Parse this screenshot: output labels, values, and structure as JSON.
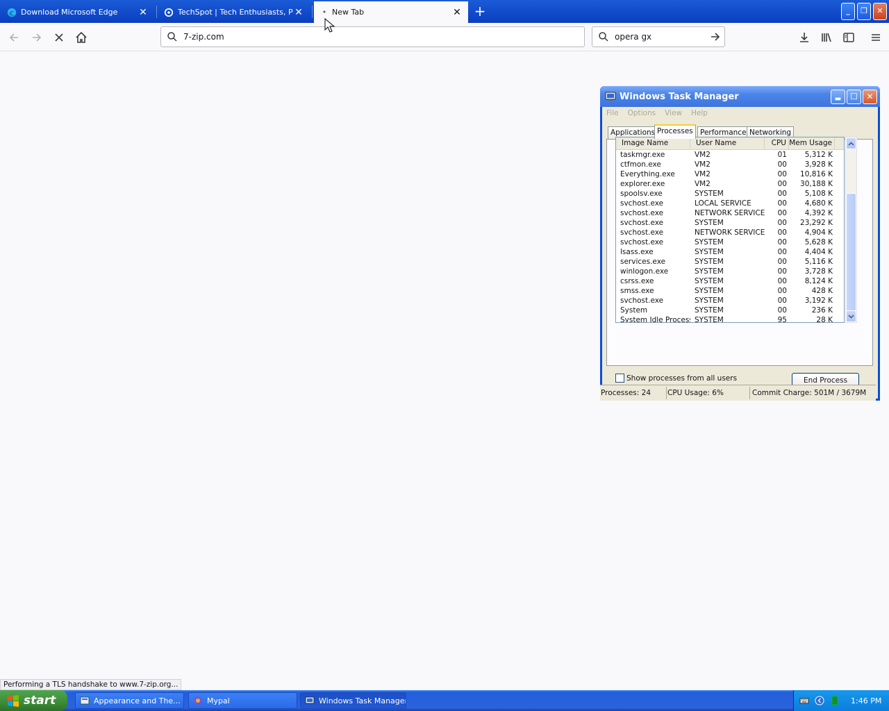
{
  "browser": {
    "tabs": [
      {
        "title": "Download Microsoft Edge",
        "active": false
      },
      {
        "title": "TechSpot | Tech Enthusiasts, Power Users",
        "active": false
      },
      {
        "title": "New Tab",
        "active": true
      }
    ],
    "url": "7-zip.com",
    "search_value": "opera gx",
    "status_text": "Performing a TLS handshake to www.7-zip.org..."
  },
  "task_manager": {
    "title": "Windows Task Manager",
    "menu": [
      "File",
      "Options",
      "View",
      "Help"
    ],
    "tabs": [
      "Applications",
      "Processes",
      "Performance",
      "Networking"
    ],
    "active_tab": "Processes",
    "columns": [
      "Image Name",
      "User Name",
      "CPU",
      "Mem Usage"
    ],
    "processes": [
      {
        "name": "taskmgr.exe",
        "user": "VM2",
        "cpu": "01",
        "mem": "5,312 K"
      },
      {
        "name": "ctfmon.exe",
        "user": "VM2",
        "cpu": "00",
        "mem": "3,928 K"
      },
      {
        "name": "Everything.exe",
        "user": "VM2",
        "cpu": "00",
        "mem": "10,816 K"
      },
      {
        "name": "explorer.exe",
        "user": "VM2",
        "cpu": "00",
        "mem": "30,188 K"
      },
      {
        "name": "spoolsv.exe",
        "user": "SYSTEM",
        "cpu": "00",
        "mem": "5,108 K"
      },
      {
        "name": "svchost.exe",
        "user": "LOCAL SERVICE",
        "cpu": "00",
        "mem": "4,680 K"
      },
      {
        "name": "svchost.exe",
        "user": "NETWORK SERVICE",
        "cpu": "00",
        "mem": "4,392 K"
      },
      {
        "name": "svchost.exe",
        "user": "SYSTEM",
        "cpu": "00",
        "mem": "23,292 K"
      },
      {
        "name": "svchost.exe",
        "user": "NETWORK SERVICE",
        "cpu": "00",
        "mem": "4,904 K"
      },
      {
        "name": "svchost.exe",
        "user": "SYSTEM",
        "cpu": "00",
        "mem": "5,628 K"
      },
      {
        "name": "lsass.exe",
        "user": "SYSTEM",
        "cpu": "00",
        "mem": "4,404 K"
      },
      {
        "name": "services.exe",
        "user": "SYSTEM",
        "cpu": "00",
        "mem": "5,116 K"
      },
      {
        "name": "winlogon.exe",
        "user": "SYSTEM",
        "cpu": "00",
        "mem": "3,728 K"
      },
      {
        "name": "csrss.exe",
        "user": "SYSTEM",
        "cpu": "00",
        "mem": "8,124 K"
      },
      {
        "name": "smss.exe",
        "user": "SYSTEM",
        "cpu": "00",
        "mem": "428 K"
      },
      {
        "name": "svchost.exe",
        "user": "SYSTEM",
        "cpu": "00",
        "mem": "3,192 K"
      },
      {
        "name": "System",
        "user": "SYSTEM",
        "cpu": "00",
        "mem": "236 K"
      },
      {
        "name": "System Idle Process",
        "user": "SYSTEM",
        "cpu": "95",
        "mem": "28 K"
      }
    ],
    "show_all_label": "Show processes from all users",
    "show_all_checked": false,
    "end_process_label": "End Process",
    "status": {
      "processes": "Processes: 24",
      "cpu_usage": "CPU Usage: 6%",
      "commit": "Commit Charge: 501M / 3679M"
    }
  },
  "taskbar": {
    "start_label": "start",
    "tasks": [
      {
        "label": "Appearance and The...",
        "active": false
      },
      {
        "label": "Mypal",
        "active": false
      },
      {
        "label": "Windows Task Manager",
        "active": true
      }
    ],
    "clock": "1:46 PM"
  },
  "icons": {
    "back": "back-arrow-icon",
    "forward": "forward-arrow-icon",
    "stop": "stop-icon",
    "home": "home-icon",
    "search": "search-icon",
    "go": "go-arrow-icon",
    "download": "download-icon",
    "library": "library-icon",
    "sidebar": "sidebar-icon",
    "menu": "hamburger-menu-icon"
  },
  "colors": {
    "tab_strip": "#0a3fbf",
    "xp_title": "#3d74de",
    "xp_start": "#3c8b36",
    "xp_dialog": "#ece9d8"
  }
}
